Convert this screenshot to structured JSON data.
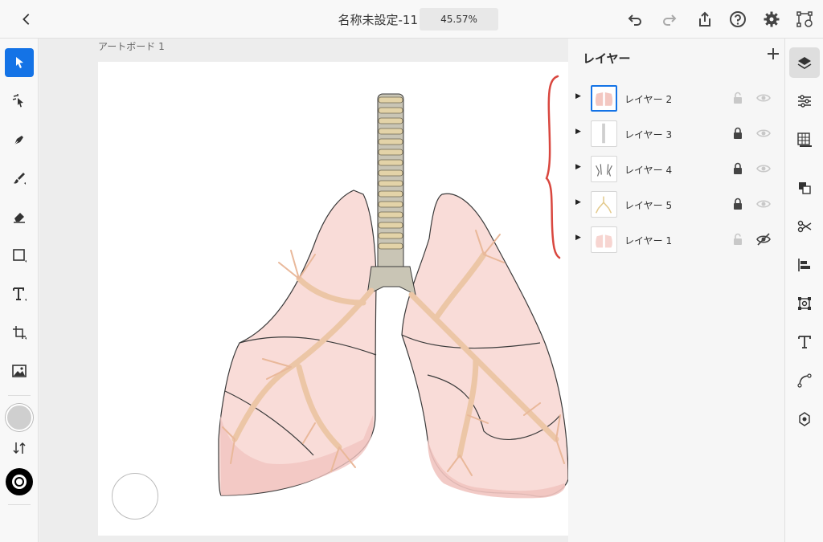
{
  "header": {
    "document_title": "名称未設定-11",
    "zoom_level": "45.57%"
  },
  "canvas": {
    "artboard_label": "アートボード 1"
  },
  "layers_panel": {
    "title": "レイヤー",
    "add_icon": "plus-icon",
    "layers": [
      {
        "name": "レイヤー 2",
        "locked": false,
        "visible": true,
        "selected": true
      },
      {
        "name": "レイヤー 3",
        "locked": true,
        "visible": true,
        "selected": false
      },
      {
        "name": "レイヤー 4",
        "locked": true,
        "visible": true,
        "selected": false
      },
      {
        "name": "レイヤー 5",
        "locked": true,
        "visible": true,
        "selected": false
      },
      {
        "name": "レイヤー 1",
        "locked": false,
        "visible": false,
        "selected": false
      }
    ]
  },
  "colors": {
    "accent": "#1473e6",
    "annotation_brace": "#d9473f",
    "fill_swatch": "#cfcfcf",
    "stroke_swatch": "#000000"
  }
}
